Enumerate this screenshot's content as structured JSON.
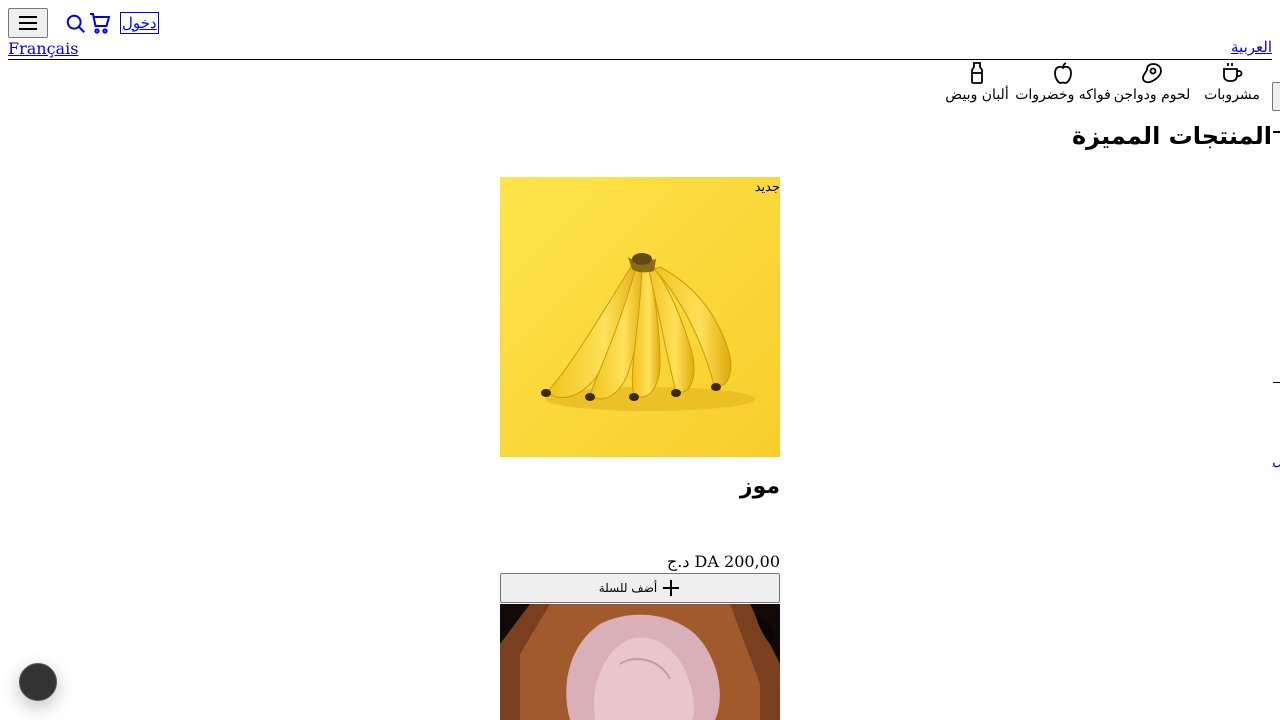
{
  "header": {
    "menu_icon": "hamburger-icon",
    "search_icon": "search-icon",
    "cart_icon": "cart-icon",
    "login_label": "دخول",
    "lang_fr": "Français",
    "lang_ar": "العربية"
  },
  "categories": [
    {
      "label": "مشروبات",
      "icon": "cup-icon"
    },
    {
      "label": "لحوم ودواجن",
      "icon": "steak-icon"
    },
    {
      "label": "فواكه وخضروات",
      "icon": "apple-icon"
    },
    {
      "label": "ألبان وبيض",
      "icon": "milk-bottle-icon"
    }
  ],
  "featured": {
    "title": "المنتجات المميزة",
    "edge_link_text": "ل"
  },
  "products": [
    {
      "badge": "جديد",
      "name": "موز",
      "price": "د.ج DA 200,00",
      "add_label": "أضف للسلة",
      "add_icon": "plus-icon",
      "image": "bananas-photo"
    },
    {
      "image": "raw-chicken-photo"
    }
  ],
  "colors": {
    "link": "#0000ee",
    "banana_bg": "#fbd838",
    "button_bg": "#efefef"
  }
}
